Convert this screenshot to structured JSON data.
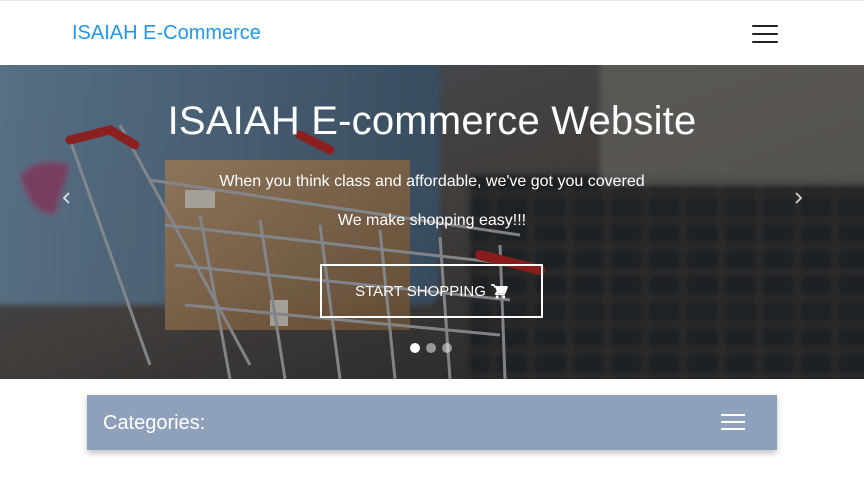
{
  "navbar": {
    "brand": "ISAIAH E-Commerce",
    "menu_icon": "hamburger-menu-icon"
  },
  "hero": {
    "title": "ISAIAH E-commerce Website",
    "subtitle_1": "When you think class and affordable, we've got you covered",
    "subtitle_2": "We make shopping easy!!!",
    "cta_label": "START SHOPPING",
    "cta_icon": "shopping-cart-icon",
    "prev_icon": "chevron-left-icon",
    "next_icon": "chevron-right-icon",
    "slides_total": 3,
    "active_slide": 1
  },
  "categories": {
    "label": "Categories:",
    "menu_icon": "hamburger-menu-icon"
  },
  "colors": {
    "brand": "#2196f3",
    "category_bar": "#8fa0bb"
  }
}
